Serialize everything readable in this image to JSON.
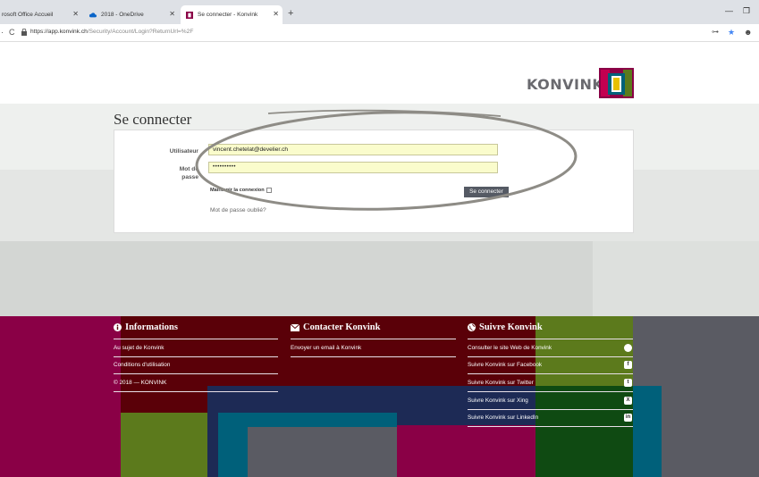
{
  "browser": {
    "tabs": [
      {
        "label": "rosoft Office Accueil"
      },
      {
        "label": "2018 - OneDrive"
      },
      {
        "label": "Se connecter - Konvink"
      }
    ],
    "url_host": "https://app.konvink.ch",
    "url_path": "/Security/Account/Login?ReturnUrl=%2F"
  },
  "brand": {
    "name": "KONVINK",
    "colors": {
      "accent": "#8a0046",
      "olive": "#5c7a1c",
      "teal": "#00607a",
      "dark_red": "#5a0008",
      "navy": "#1d2a55",
      "green": "#0f4a12"
    }
  },
  "login": {
    "title": "Se connecter",
    "username_label": "Utilisateur",
    "username_value": "vincent.chetelat@develier.ch",
    "password_label_line1": "Mot de",
    "password_label_line2": "passe",
    "password_value": "••••••••••",
    "remember_label": "Maintenir la connexion",
    "submit_label": "Se connecter",
    "forgot_label": "Mot de passe oublié?"
  },
  "footer": {
    "info": {
      "title": "Informations",
      "links": [
        "Au sujet de Konvink",
        "Conditions d'utilisation",
        "© 2018 — KONVINK"
      ]
    },
    "contact": {
      "title": "Contacter Konvink",
      "links": [
        "Envoyer un email à Konvink"
      ]
    },
    "follow": {
      "title": "Suivre Konvink",
      "links": [
        {
          "label": "Consulter le site Web de Konvink",
          "icon": "globe-icon"
        },
        {
          "label": "Suivre Konvink sur Facebook",
          "icon": "facebook-icon"
        },
        {
          "label": "Suivre Konvink sur Twitter",
          "icon": "twitter-icon"
        },
        {
          "label": "Suivre Konvink sur Xing",
          "icon": "xing-icon"
        },
        {
          "label": "Suivre Konvink sur LinkedIn",
          "icon": "linkedin-icon"
        }
      ],
      "icon_glyphs": [
        "",
        "f",
        "t",
        "X",
        "in"
      ]
    }
  }
}
